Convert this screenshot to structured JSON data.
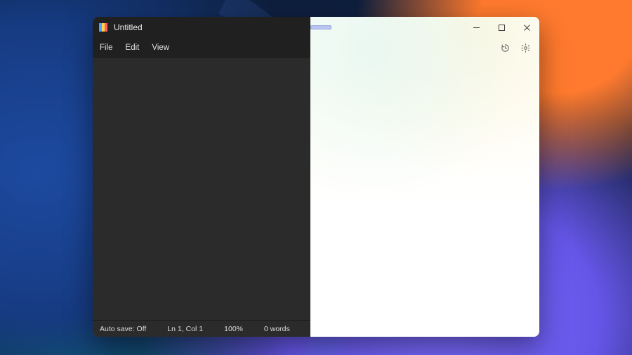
{
  "window": {
    "title": "Untitled"
  },
  "menu": {
    "file": "File",
    "edit": "Edit",
    "view": "View"
  },
  "status": {
    "autosave": "Auto save: Off",
    "position": "Ln 1, Col 1",
    "zoom": "100%",
    "words": "0 words"
  }
}
